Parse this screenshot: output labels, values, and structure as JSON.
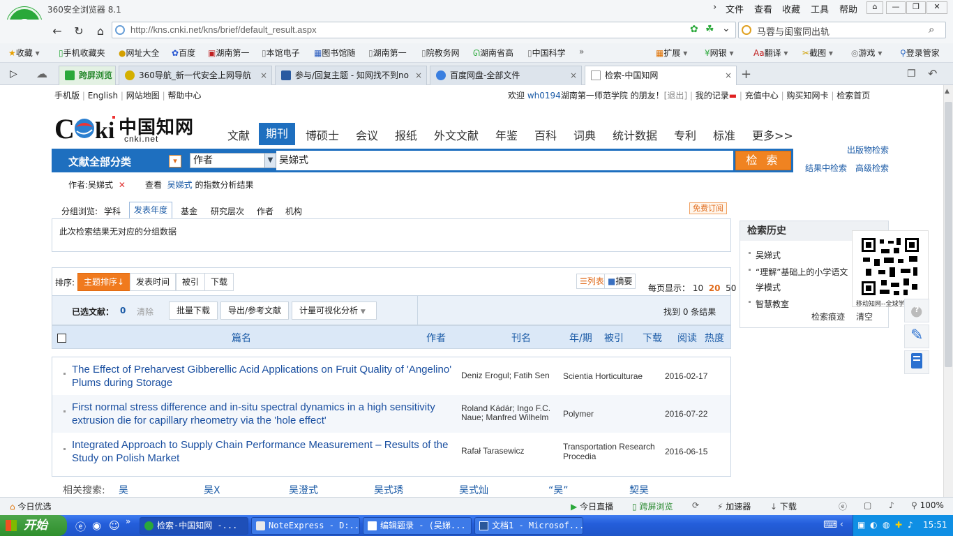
{
  "browser": {
    "title": "360安全浏览器 8.1",
    "menu": [
      "文件",
      "查看",
      "收藏",
      "工具",
      "帮助"
    ],
    "url": "http://kns.cnki.net/kns/brief/default_result.aspx",
    "search_value": "马蓉与闺蜜同出轨",
    "favorites": [
      "收藏",
      "手机收藏夹",
      "网址大全",
      "百度",
      "湖南第一",
      "本馆电子",
      "图书馆随",
      "湖南第一",
      "院教务网",
      "湖南省高",
      "中国科学"
    ],
    "fav_right": [
      "扩展",
      "网银",
      "翻译",
      "截图",
      "游戏",
      "登录管家"
    ],
    "tabs": [
      {
        "label": "跨屏浏览"
      },
      {
        "label": "360导航_新一代安全上网导航"
      },
      {
        "label": "参与/回复主题 - 知网找不到no"
      },
      {
        "label": "百度网盘-全部文件"
      },
      {
        "label": "检索-中国知网"
      }
    ]
  },
  "top_links": {
    "left": [
      "手机版",
      "English",
      "网站地图",
      "帮助中心"
    ],
    "welcome": "欢迎",
    "user": "wh0194",
    "user_org": "湖南第一师范学院 的朋友！",
    "logout": "[退出]",
    "right": [
      "我的记录",
      "充值中心",
      "购买知网卡",
      "检索首页"
    ]
  },
  "logo_text": "cnki.net",
  "logo_cn": "中国知网",
  "channels": [
    "文献",
    "期刊",
    "博硕士",
    "会议",
    "报纸",
    "外文文献",
    "年鉴",
    "百科",
    "词典",
    "统计数据",
    "专利",
    "标准",
    "更多>>"
  ],
  "search": {
    "category": "文献全部分类",
    "field": "作者",
    "keyword": "吴娣式",
    "button": "检 索",
    "right_links": [
      "出版物检索",
      "结果中检索",
      "高级检索"
    ]
  },
  "crumbs": {
    "filter": "作者:吴娣式",
    "see": "查看",
    "name": "吴娣式",
    "suffix": "的指数分析结果"
  },
  "group": {
    "label": "分组浏览:",
    "items": [
      "学科",
      "发表年度",
      "基金",
      "研究层次",
      "作者",
      "机构"
    ],
    "subscribe": "免费订阅",
    "empty_msg": "此次检索结果无对应的分组数据"
  },
  "sort": {
    "label": "排序:",
    "items": [
      "主题排序",
      "发表时间",
      "被引",
      "下载"
    ],
    "view_list": "列表",
    "view_abstract": "摘要",
    "per_page_label": "每页显示：",
    "per_page": [
      "10",
      "20",
      "50"
    ]
  },
  "selection": {
    "label": "已选文献：",
    "count": "0",
    "clear": "清除",
    "buttons": [
      "批量下载",
      "导出/参考文献",
      "计量可视化分析"
    ],
    "found": "找到 0 条结果"
  },
  "table_headers": [
    "篇名",
    "作者",
    "刊名",
    "年/期",
    "被引",
    "下载",
    "阅读",
    "热度"
  ],
  "results": [
    {
      "title": "The Effect of Preharvest Gibberellic Acid Applications on Fruit Quality of 'Angelino' Plums during Storage",
      "authors": "Deniz Erogul; Fatih Sen",
      "source": "Scientia Horticulturae",
      "date": "2016-02-17"
    },
    {
      "title": "First normal stress difference and in-situ spectral dynamics in a high sensitivity extrusion die for capillary rheometry via the 'hole effect'",
      "authors": "Roland Kádár; Ingo F.C. Naue; Manfred Wilhelm",
      "source": "Polymer",
      "date": "2016-07-22"
    },
    {
      "title": "Integrated Approach to Supply Chain Performance Measurement – Results of the Study on Polish Market",
      "authors": "Rafał Tarasewicz",
      "source": "Transportation Research Procedia",
      "date": "2016-06-15"
    }
  ],
  "related": {
    "label": "相关搜索:",
    "items": [
      "吴",
      "吴X",
      "吴澄式",
      "吴式琇",
      "吴式灿",
      "“吴”",
      "契吴"
    ]
  },
  "history": {
    "title": "检索历史",
    "items": [
      "吴娣式",
      "“理解”基础上的小学语文",
      "学模式",
      "智慧教室"
    ],
    "footer": [
      "检索痕迹",
      "清空"
    ],
    "qr_caption": "移动知网--全球学"
  },
  "statusbar": {
    "left": "今日优选",
    "right": [
      "今日直播",
      "跨屏浏览",
      "加速器",
      "下载",
      "100%"
    ]
  },
  "taskbar": {
    "start": "开始",
    "tasks": [
      "检索-中国知网 -...",
      "NoteExpress - D:...",
      "编辑题录 - (吴娣...",
      "文档1 - Microsof..."
    ],
    "time": "15:51"
  },
  "colors": {
    "brand_blue": "#1e6fbf",
    "accent_orange": "#f08321",
    "link": "#1a5aa6"
  }
}
